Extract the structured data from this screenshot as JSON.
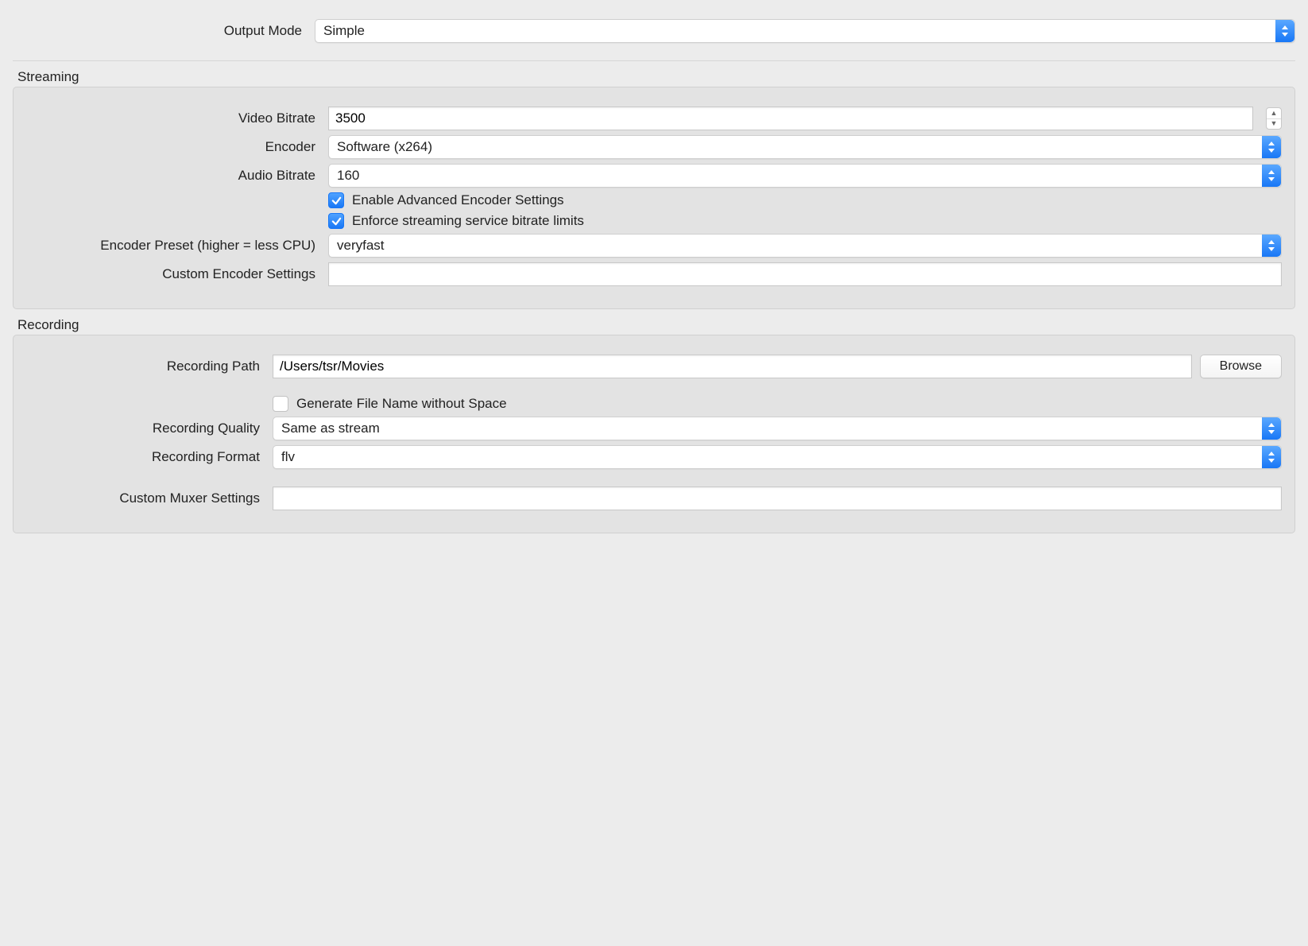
{
  "outputMode": {
    "label": "Output Mode",
    "value": "Simple"
  },
  "streaming": {
    "title": "Streaming",
    "videoBitrate": {
      "label": "Video Bitrate",
      "value": "3500"
    },
    "encoder": {
      "label": "Encoder",
      "value": "Software (x264)"
    },
    "audioBitrate": {
      "label": "Audio Bitrate",
      "value": "160"
    },
    "enableAdvanced": {
      "label": "Enable Advanced Encoder Settings",
      "checked": true
    },
    "enforceLimits": {
      "label": "Enforce streaming service bitrate limits",
      "checked": true
    },
    "preset": {
      "label": "Encoder Preset (higher = less CPU)",
      "value": "veryfast"
    },
    "customEncoder": {
      "label": "Custom Encoder Settings",
      "value": ""
    }
  },
  "recording": {
    "title": "Recording",
    "path": {
      "label": "Recording Path",
      "value": "/Users/tsr/Movies"
    },
    "browse": "Browse",
    "noSpaceName": {
      "label": "Generate File Name without Space",
      "checked": false
    },
    "quality": {
      "label": "Recording Quality",
      "value": "Same as stream"
    },
    "format": {
      "label": "Recording Format",
      "value": "flv"
    },
    "muxer": {
      "label": "Custom Muxer Settings",
      "value": ""
    }
  }
}
